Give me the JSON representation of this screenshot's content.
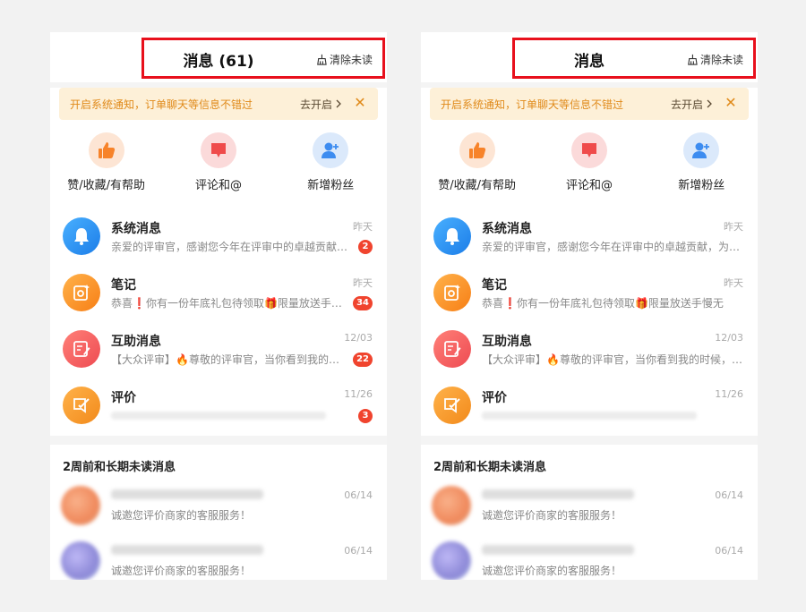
{
  "panels": [
    {
      "header": {
        "title": "消息 (61)",
        "clear_label": "清除未读"
      },
      "notice": {
        "text": "开启系统通知，订单聊天等信息不错过",
        "action": "去开启",
        "close": "✕"
      },
      "quick_actions": [
        {
          "label": "赞/收藏/有帮助",
          "icon": "thumbs-up-icon"
        },
        {
          "label": "评论和@",
          "icon": "comment-icon"
        },
        {
          "label": "新增粉丝",
          "icon": "add-user-icon"
        }
      ],
      "messages": [
        {
          "title": "系统消息",
          "time": "昨天",
          "preview": "亲爱的评审官，感谢您今年在评审中的卓越贡献，为更多人带来了帮助",
          "badge": "2",
          "icon": "bell-icon"
        },
        {
          "title": "笔记",
          "time": "昨天",
          "preview": "恭喜❗你有一份年底礼包待领取🎁限量放送手慢无",
          "badge": "34",
          "icon": "camera-note-icon"
        },
        {
          "title": "互助消息",
          "time": "12/03",
          "preview": "【大众评审】🔥尊敬的评审官，当你看到我的时候，说明你已经",
          "badge": "22",
          "icon": "edit-doc-icon"
        },
        {
          "title": "评价",
          "time": "11/26",
          "preview": "",
          "badge": "3",
          "icon": "review-pen-icon"
        }
      ],
      "section": {
        "title": "2周前和长期未读消息",
        "items": [
          {
            "preview": "诚邀您评价商家的客服服务！",
            "time": "06/14"
          },
          {
            "preview": "诚邀您评价商家的客服服务！",
            "time": "06/14"
          }
        ]
      }
    },
    {
      "header": {
        "title": "消息",
        "clear_label": "清除未读"
      },
      "notice": {
        "text": "开启系统通知，订单聊天等信息不错过",
        "action": "去开启",
        "close": "✕"
      },
      "quick_actions": [
        {
          "label": "赞/收藏/有帮助",
          "icon": "thumbs-up-icon"
        },
        {
          "label": "评论和@",
          "icon": "comment-icon"
        },
        {
          "label": "新增粉丝",
          "icon": "add-user-icon"
        }
      ],
      "messages": [
        {
          "title": "系统消息",
          "time": "昨天",
          "preview": "亲爱的评审官，感谢您今年在评审中的卓越贡献，为更多人带来了帮助",
          "icon": "bell-icon"
        },
        {
          "title": "笔记",
          "time": "昨天",
          "preview": "恭喜❗你有一份年底礼包待领取🎁限量放送手慢无",
          "icon": "camera-note-icon"
        },
        {
          "title": "互助消息",
          "time": "12/03",
          "preview": "【大众评审】🔥尊敬的评审官，当你看到我的时候，说明你已经",
          "icon": "edit-doc-icon"
        },
        {
          "title": "评价",
          "time": "11/26",
          "preview": "",
          "icon": "review-pen-icon"
        }
      ],
      "section": {
        "title": "2周前和长期未读消息",
        "items": [
          {
            "preview": "诚邀您评价商家的客服服务！",
            "time": "06/14"
          },
          {
            "preview": "诚邀您评价商家的客服服务！",
            "time": "06/14"
          }
        ]
      }
    }
  ],
  "colors": {
    "highlight": "#e8101c",
    "badge": "#f0442e",
    "notice_bg": "#fdf0d8",
    "notice_text": "#e08a1a"
  }
}
